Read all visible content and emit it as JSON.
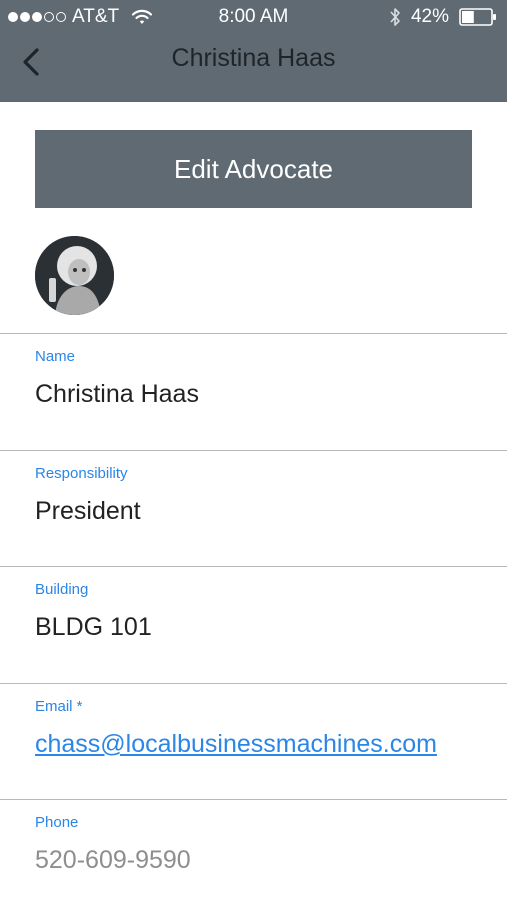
{
  "status_bar": {
    "carrier": "AT&T",
    "time": "8:00 AM",
    "battery": "42%",
    "battery_level": 0.42
  },
  "nav": {
    "title": "Christina Haas",
    "back_icon": "chevron-left-icon"
  },
  "edit_button_label": "Edit Advocate",
  "fields": {
    "name": {
      "label": "Name",
      "value": "Christina Haas"
    },
    "responsibility": {
      "label": "Responsibility",
      "value": "President"
    },
    "building": {
      "label": "Building",
      "value": "BLDG 101"
    },
    "email": {
      "label": "Email *",
      "value": "chass@localbusinessmachines.com"
    },
    "phone": {
      "label": "Phone",
      "placeholder": "520-609-9590"
    }
  },
  "colors": {
    "header": "#5f6a73",
    "accent": "#2b86e6",
    "divider": "#b8b8b8"
  }
}
